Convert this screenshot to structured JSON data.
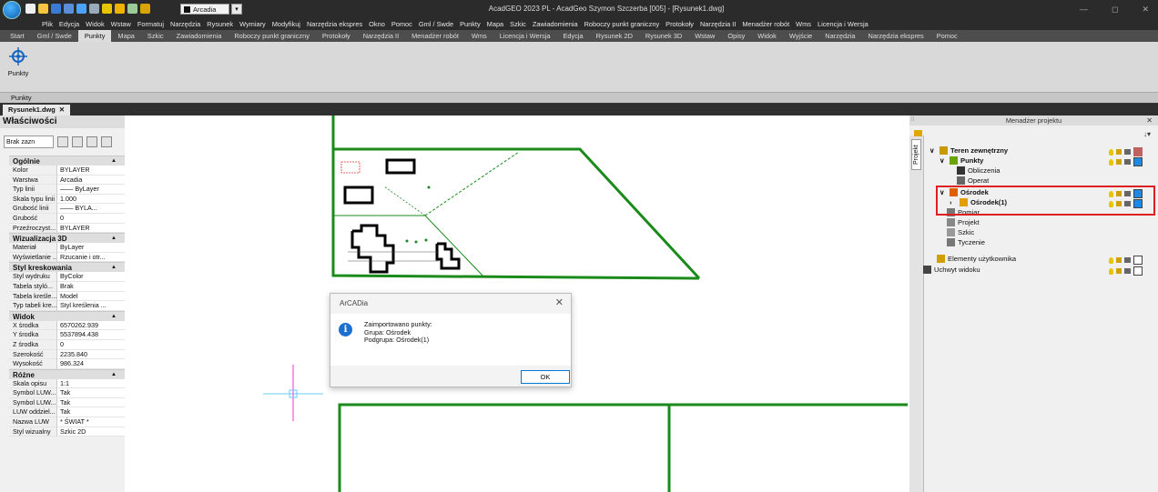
{
  "titlebar": {
    "title": "AcadGEO 2023 PL - AcadGeo Szymon Szczerba [005] - [Rysunek1.dwg]",
    "layer": "Arcadia",
    "minimize": "—",
    "restore": "◻",
    "close": "✕"
  },
  "menu": [
    "Plik",
    "Edycja",
    "Widok",
    "Wstaw",
    "Formatuj",
    "Narzędzia",
    "Rysunek",
    "Wymiary",
    "Modyfikuj",
    "Narzędzia ekspres",
    "Okno",
    "Pomoc",
    "Gml / Swde",
    "Punkty",
    "Mapa",
    "Szkic",
    "Zawiadomienia",
    "Roboczy punkt graniczny",
    "Protokoły",
    "Narzędzia II",
    "Menadżer robót",
    "Wms",
    "Licencja i Wersja"
  ],
  "tabs": [
    "Start",
    "Gml / Swde",
    "Punkty",
    "Mapa",
    "Szkic",
    "Zawiadomienia",
    "Roboczy punkt graniczny",
    "Protokoły",
    "Narzędzia II",
    "Menadżer robót",
    "Wms",
    "Licencja i Wersja",
    "Edycja",
    "Rysunek 2D",
    "Rysunek 3D",
    "Wstaw",
    "Opisy",
    "Widok",
    "Wyjście",
    "Narzędzia",
    "Narzędzia ekspres",
    "Pomoc"
  ],
  "active_tab": "Punkty",
  "ribbon": {
    "button": "Punkty",
    "panel": "Punkty"
  },
  "document": {
    "tab": "Rysunek1.dwg",
    "close": "✕"
  },
  "properties": {
    "title": "Właściwości",
    "selection": "Brak zazn",
    "sections": [
      {
        "title": "Ogólnie",
        "rows": [
          [
            "Kolor",
            "BYLAYER"
          ],
          [
            "Warstwa",
            "Arcadia"
          ],
          [
            "Typ linii",
            "—— ByLayer"
          ],
          [
            "Skala typu linii",
            "1.000"
          ],
          [
            "Grubość linii",
            "—— BYLA..."
          ],
          [
            "Grubość",
            "0"
          ],
          [
            "Przeźroczyst...",
            "BYLAYER"
          ]
        ]
      },
      {
        "title": "Wizualizacja 3D",
        "rows": [
          [
            "Materiał",
            "ByLayer"
          ],
          [
            "Wyświetlanie ...",
            "Rzucanie i otr..."
          ]
        ]
      },
      {
        "title": "Styl kreskowania",
        "rows": [
          [
            "Styl wydruku",
            "ByColor"
          ],
          [
            "Tabela styló...",
            "Brak"
          ],
          [
            "Tabela kreśle...",
            "Model"
          ],
          [
            "Typ tabeli kre...",
            "Styl kreślenia ..."
          ]
        ]
      },
      {
        "title": "Widok",
        "rows": [
          [
            "X środka",
            "6570262.939"
          ],
          [
            "Y środka",
            "5537894.438"
          ],
          [
            "Z środka",
            "0"
          ],
          [
            "Szerokość",
            "2235.840"
          ],
          [
            "Wysokość",
            "986.324"
          ]
        ]
      },
      {
        "title": "Różne",
        "rows": [
          [
            "Skala opisu",
            "1:1"
          ],
          [
            "Symbol LUW...",
            "Tak"
          ],
          [
            "Symbol LUW...",
            "Tak"
          ],
          [
            "LUW oddziel...",
            "Tak"
          ],
          [
            "Nazwa LUW",
            "* ŚWIAT *"
          ],
          [
            "Styl wizualny",
            "Szkic 2D"
          ]
        ]
      }
    ]
  },
  "project_manager": {
    "title": "Menadżer projektu",
    "side_tab": "Projekt",
    "nodes": [
      {
        "label": "Teren zewnętrzny",
        "bold": true
      },
      {
        "label": "Punkty",
        "bold": true
      },
      {
        "label": "Obliczenia",
        "bold": false
      },
      {
        "label": "Operat",
        "bold": false
      },
      {
        "label": "Ośrodek",
        "bold": true
      },
      {
        "label": "Ośrodek(1)",
        "bold": true
      },
      {
        "label": "Pomiar",
        "bold": false
      },
      {
        "label": "Projekt",
        "bold": false
      },
      {
        "label": "Szkic",
        "bold": false
      },
      {
        "label": "Tyczenie",
        "bold": false
      },
      {
        "label": "Elementy użytkownika",
        "bold": false
      },
      {
        "label": "Uchwyt widoku",
        "bold": false
      }
    ],
    "swatch_color": "#1e88e5",
    "highlight_color": "#e02020"
  },
  "dialog": {
    "title": "ArCADia",
    "close": "✕",
    "line1": "Zaimportowano punkty:",
    "line2": "Grupa: Ośrodek",
    "line3": "Podgrupa: Ośrodek(1)",
    "ok": "OK",
    "info_icon": "i"
  },
  "colors": {
    "parcel_line": "#1a8a1a",
    "building": "#000000",
    "crosshair_x": "#66ccff",
    "crosshair_y": "#ff33cc"
  }
}
